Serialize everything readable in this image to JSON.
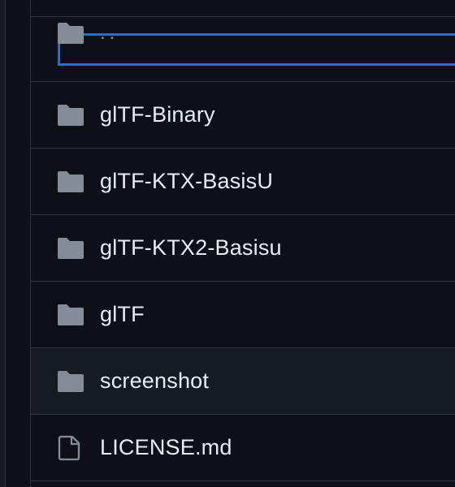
{
  "parent_row": {
    "label": "..",
    "icon": "folder-icon"
  },
  "entries": [
    {
      "name": "glTF-Binary",
      "icon": "folder-icon"
    },
    {
      "name": "glTF-KTX-BasisU",
      "icon": "folder-icon"
    },
    {
      "name": "glTF-KTX2-Basisu",
      "icon": "folder-icon"
    },
    {
      "name": "glTF",
      "icon": "folder-icon"
    },
    {
      "name": "screenshot",
      "icon": "folder-icon"
    },
    {
      "name": "LICENSE.md",
      "icon": "file-icon"
    }
  ],
  "colors": {
    "background": "#0d1117",
    "border": "#30363d",
    "text": "#e6edf3",
    "icon": "#848d97",
    "focus": "#1f6feb",
    "hover_row": "#161b22"
  }
}
